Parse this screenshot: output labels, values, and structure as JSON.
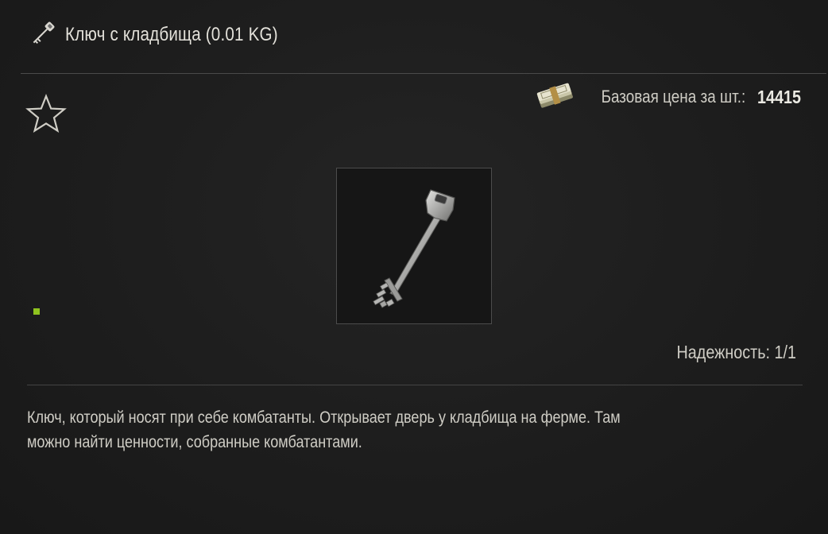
{
  "header": {
    "icon": "key-icon",
    "title": "Ключ с кладбища (0.01 KG)"
  },
  "favorite": {
    "icon": "star-outline-icon"
  },
  "price": {
    "icon": "money-stack-icon",
    "label": "Базовая цена за шт.:",
    "value": "14415"
  },
  "item": {
    "icon": "cemetery-key-icon"
  },
  "status": {
    "color": "#8fc31f"
  },
  "durability": {
    "text": "Надежность: 1/1"
  },
  "description": {
    "text": "Ключ, который носят при себе комбатанты. Открывает дверь у кладбища на ферме. Там\nможно найти ценности, собранные комбатантами."
  }
}
